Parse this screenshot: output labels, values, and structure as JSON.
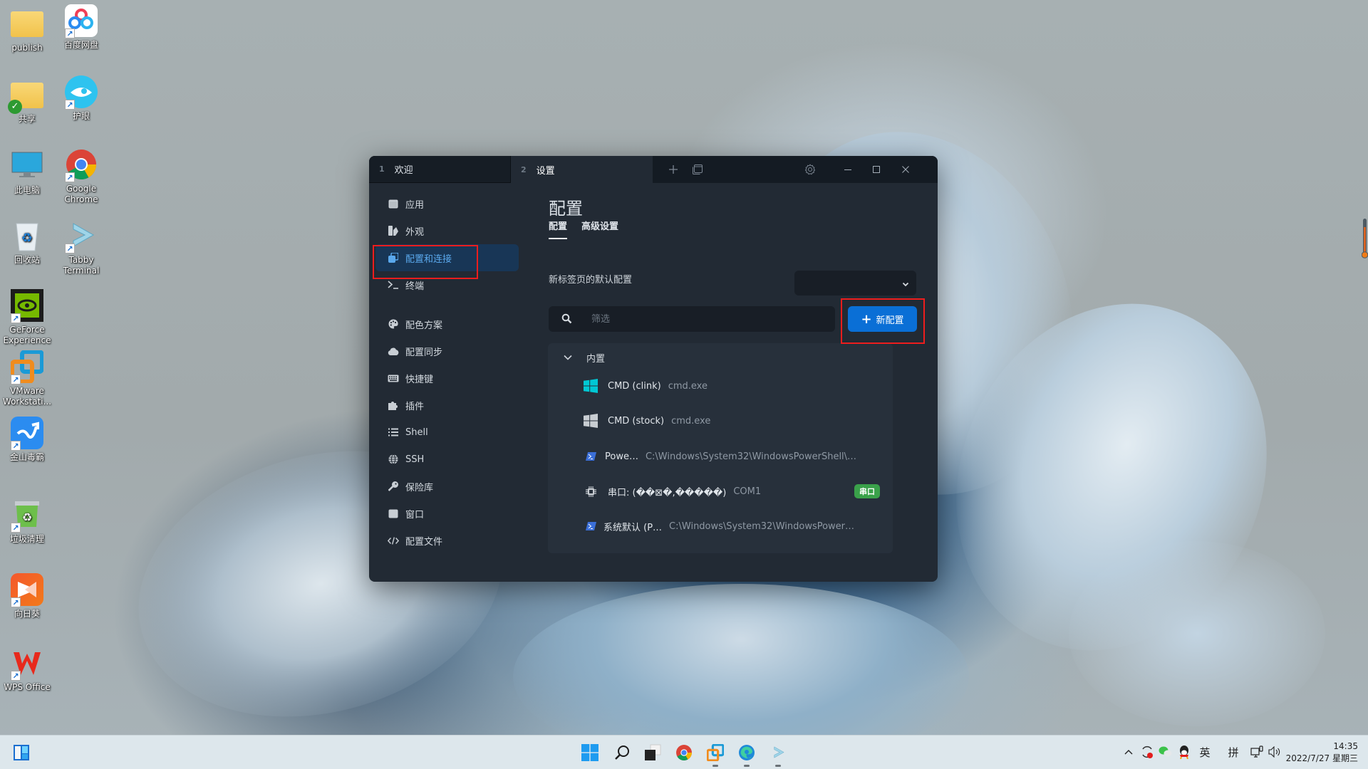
{
  "desktop": {
    "icons": [
      {
        "label": "publish",
        "icon": "folder-icon"
      },
      {
        "label": "百度网盘",
        "icon": "baidu-netdisk-icon"
      },
      {
        "label": "共享",
        "icon": "shared-folder-icon"
      },
      {
        "label": "护眼",
        "icon": "eye-care-icon"
      },
      {
        "label": "此电脑",
        "icon": "computer-icon"
      },
      {
        "label": "Google Chrome",
        "icon": "chrome-icon"
      },
      {
        "label": "回收站",
        "icon": "recycle-bin-icon"
      },
      {
        "label": "Tabby Terminal",
        "icon": "tabby-icon"
      },
      {
        "label": "GeForce Experience",
        "icon": "geforce-icon"
      },
      {
        "label": "VMware Workstati...",
        "icon": "vmware-icon"
      },
      {
        "label": "金山毒霸",
        "icon": "kingsoft-antivirus-icon"
      },
      {
        "label": "垃圾清理",
        "icon": "cleanup-icon"
      },
      {
        "label": "向日葵",
        "icon": "sunlogin-icon"
      },
      {
        "label": "WPS Office",
        "icon": "wps-icon"
      }
    ]
  },
  "window": {
    "tabs": [
      {
        "num": "1",
        "label": "欢迎"
      },
      {
        "num": "2",
        "label": "设置"
      }
    ],
    "active_tab": 1,
    "sidebar": {
      "items": [
        {
          "label": "应用",
          "icon": "window-icon"
        },
        {
          "label": "外观",
          "icon": "appearance-icon"
        },
        {
          "label": "配置和连接",
          "icon": "profiles-icon"
        },
        {
          "label": "终端",
          "icon": "terminal-icon"
        },
        {
          "label": "配色方案",
          "icon": "palette-icon"
        },
        {
          "label": "配置同步",
          "icon": "cloud-icon"
        },
        {
          "label": "快捷键",
          "icon": "keyboard-icon"
        },
        {
          "label": "插件",
          "icon": "puzzle-icon"
        },
        {
          "label": "Shell",
          "icon": "list-icon"
        },
        {
          "label": "SSH",
          "icon": "globe-icon"
        },
        {
          "label": "保险库",
          "icon": "key-icon"
        },
        {
          "label": "窗口",
          "icon": "window-icon"
        },
        {
          "label": "配置文件",
          "icon": "code-icon"
        }
      ],
      "active_index": 2
    },
    "main": {
      "title": "配置",
      "subtabs": [
        "配置",
        "高级设置"
      ],
      "active_subtab": 0,
      "default_profile_label": "新标签页的默认配置",
      "default_profile_value": "",
      "filter_placeholder": "筛选",
      "filter_value": "",
      "new_profile_button": "新配置",
      "group": {
        "label": "内置",
        "expanded": true,
        "profiles": [
          {
            "name": "CMD (clink)",
            "desc": "cmd.exe",
            "icon": "windows-icon",
            "icon_color": "#00c8d4"
          },
          {
            "name": "CMD (stock)",
            "desc": "cmd.exe",
            "icon": "windows-icon",
            "icon_color": "#c8cdd2"
          },
          {
            "name": "Powe…",
            "desc": "C:\\Windows\\System32\\WindowsPowerShell\\…",
            "icon": "powershell-icon",
            "icon_color": "#3b6fd8"
          },
          {
            "name": "串口: (��⊠�,�����)",
            "desc": "COM1",
            "icon": "chip-icon",
            "icon_color": "#c8cdd2",
            "badge": "串口"
          },
          {
            "name": "系统默认 (P…",
            "desc": "C:\\Windows\\System32\\WindowsPower…",
            "icon": "powershell-icon",
            "icon_color": "#3b6fd8"
          }
        ]
      }
    }
  },
  "taskbar": {
    "apps": [
      "start-icon",
      "search-icon",
      "task-view-icon",
      "chrome-icon",
      "vmware-icon",
      "edge-icon",
      "tabby-icon"
    ],
    "tray": {
      "ime_lang": "英",
      "ime_mode": "拼",
      "time": "14:35",
      "date": "2022/7/27 星期三"
    }
  }
}
